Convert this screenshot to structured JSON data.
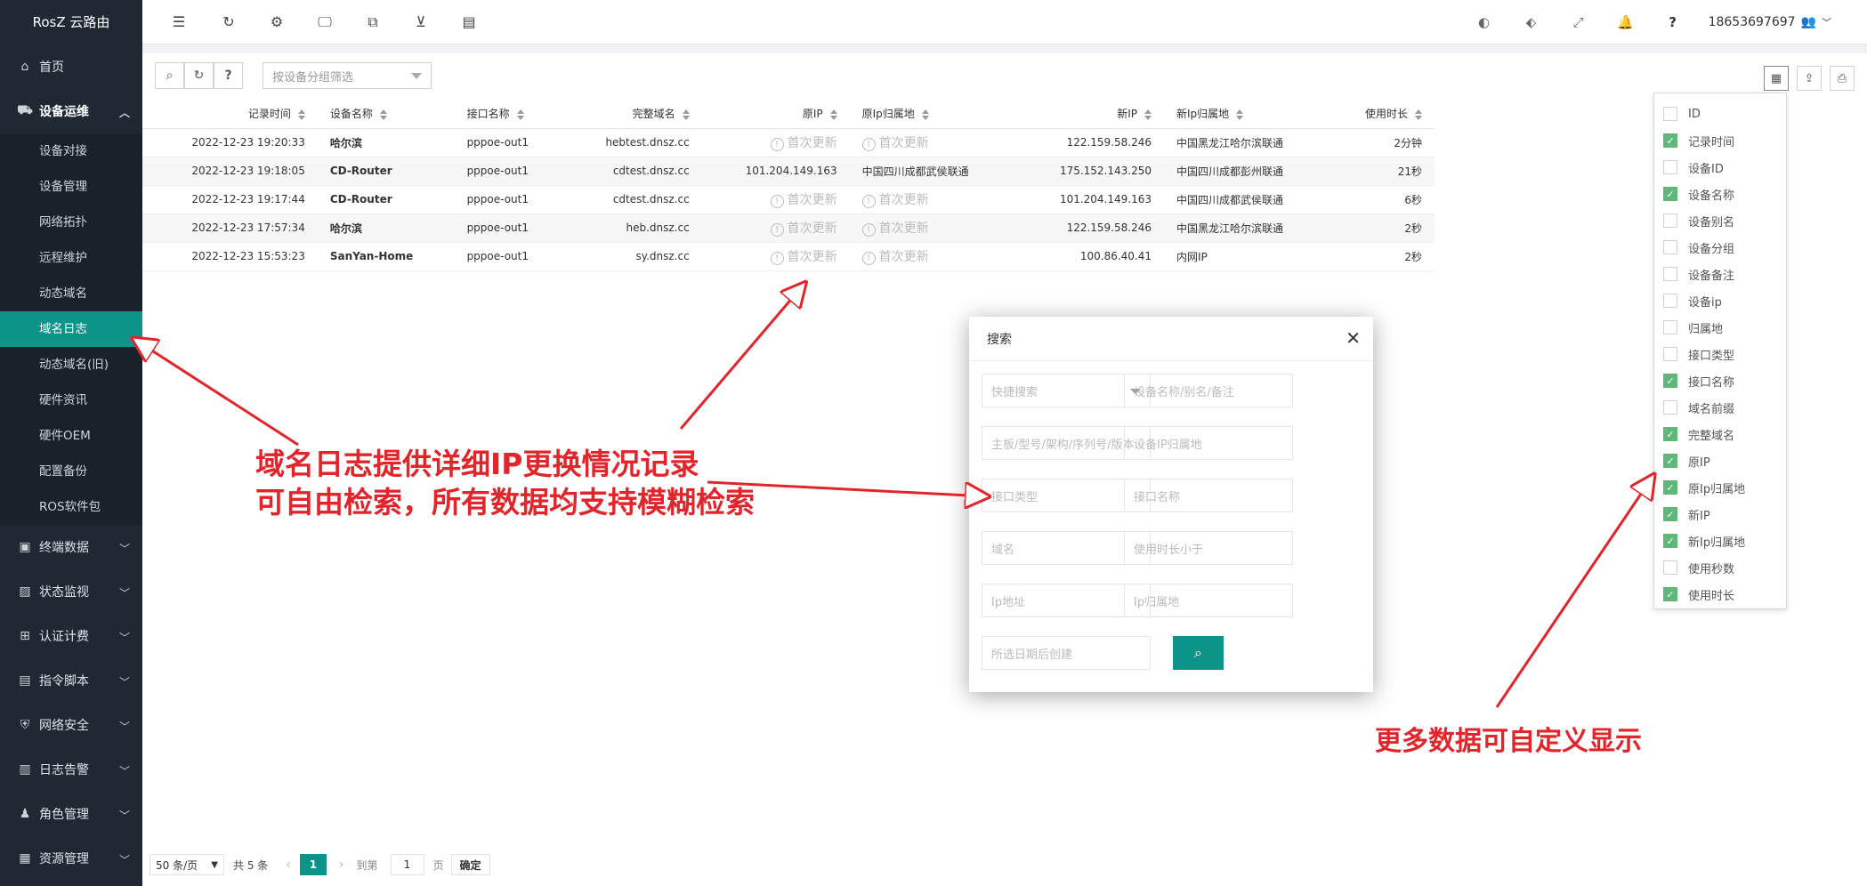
{
  "app": {
    "title": "RosZ 云路由"
  },
  "sidebar": {
    "home": "首页",
    "group_open": "设备运维",
    "sub_items": [
      "设备对接",
      "设备管理",
      "网络拓扑",
      "远程维护",
      "动态域名",
      "域名日志",
      "动态域名(旧)",
      "硬件资讯",
      "硬件OEM",
      "配置备份",
      "ROS软件包"
    ],
    "active_index": 5,
    "groups": [
      "终端数据",
      "状态监视",
      "认证计费",
      "指令脚本",
      "网络安全",
      "日志告警",
      "角色管理",
      "资源管理"
    ]
  },
  "topbar": {
    "username": "18653697697",
    "help": "?"
  },
  "toolbar": {
    "help_label": "?",
    "group_filter_placeholder": "按设备分组筛选"
  },
  "table": {
    "columns": [
      "记录时间",
      "设备名称",
      "接口名称",
      "完整域名",
      "原IP",
      "原Ip归属地",
      "新IP",
      "新Ip归属地",
      "使用时长"
    ],
    "pending_text": "首次更新",
    "rows": [
      {
        "time": "2022-12-23 19:20:33",
        "device": "哈尔滨",
        "iface": "pppoe-out1",
        "domain": "hebtest.dnsz.cc",
        "old_ip": "",
        "old_loc": "",
        "new_ip": "122.159.58.246",
        "new_loc": "中国黑龙江哈尔滨联通",
        "duration": "2分钟"
      },
      {
        "time": "2022-12-23 19:18:05",
        "device": "CD-Router",
        "iface": "pppoe-out1",
        "domain": "cdtest.dnsz.cc",
        "old_ip": "101.204.149.163",
        "old_loc": "中国四川成都武侯联通",
        "new_ip": "175.152.143.250",
        "new_loc": "中国四川成都彭州联通",
        "duration": "21秒"
      },
      {
        "time": "2022-12-23 19:17:44",
        "device": "CD-Router",
        "iface": "pppoe-out1",
        "domain": "cdtest.dnsz.cc",
        "old_ip": "",
        "old_loc": "",
        "new_ip": "101.204.149.163",
        "new_loc": "中国四川成都武侯联通",
        "duration": "6秒"
      },
      {
        "time": "2022-12-23 17:57:34",
        "device": "哈尔滨",
        "iface": "pppoe-out1",
        "domain": "heb.dnsz.cc",
        "old_ip": "",
        "old_loc": "",
        "new_ip": "122.159.58.246",
        "new_loc": "中国黑龙江哈尔滨联通",
        "duration": "2秒"
      },
      {
        "time": "2022-12-23 15:53:23",
        "device": "SanYan-Home",
        "iface": "pppoe-out1",
        "domain": "sy.dnsz.cc",
        "old_ip": "",
        "old_loc": "",
        "new_ip": "100.86.40.41",
        "new_loc": "内网IP",
        "duration": "2秒"
      }
    ]
  },
  "pagination": {
    "page_size": "50 条/页",
    "total": "共 5 条",
    "current": "1",
    "goto_label": "到第",
    "goto_value": "1",
    "page_unit": "页",
    "confirm": "确定"
  },
  "column_picker": [
    {
      "label": "ID",
      "checked": false
    },
    {
      "label": "记录时间",
      "checked": true
    },
    {
      "label": "设备ID",
      "checked": false
    },
    {
      "label": "设备名称",
      "checked": true
    },
    {
      "label": "设备别名",
      "checked": false
    },
    {
      "label": "设备分组",
      "checked": false
    },
    {
      "label": "设备备注",
      "checked": false
    },
    {
      "label": "设备ip",
      "checked": false
    },
    {
      "label": "归属地",
      "checked": false
    },
    {
      "label": "接口类型",
      "checked": false
    },
    {
      "label": "接口名称",
      "checked": true
    },
    {
      "label": "域名前缀",
      "checked": false
    },
    {
      "label": "完整域名",
      "checked": true
    },
    {
      "label": "原IP",
      "checked": true
    },
    {
      "label": "原Ip归属地",
      "checked": true
    },
    {
      "label": "新IP",
      "checked": true
    },
    {
      "label": "新Ip归属地",
      "checked": true
    },
    {
      "label": "使用秒数",
      "checked": false
    },
    {
      "label": "使用时长",
      "checked": true
    }
  ],
  "search_modal": {
    "title": "搜索",
    "fields": [
      "快捷搜索",
      "设备名称/别名/备注",
      "主板/型号/架构/序列号/版本",
      "设备IP归属地",
      "接口类型",
      "接口名称",
      "域名",
      "使用时长小于",
      "Ip地址",
      "Ip归属地",
      "所选日期后创建"
    ]
  },
  "annotations": {
    "line1": "域名日志提供详细IP更换情况记录",
    "line2": "可自由检索，所有数据均支持模糊检索",
    "columns_note": "更多数据可自定义显示"
  },
  "colors": {
    "accent": "#0d9488",
    "sidebar": "#202933",
    "annotation": "#e1252b",
    "checkbox_on": "#5fb878"
  }
}
